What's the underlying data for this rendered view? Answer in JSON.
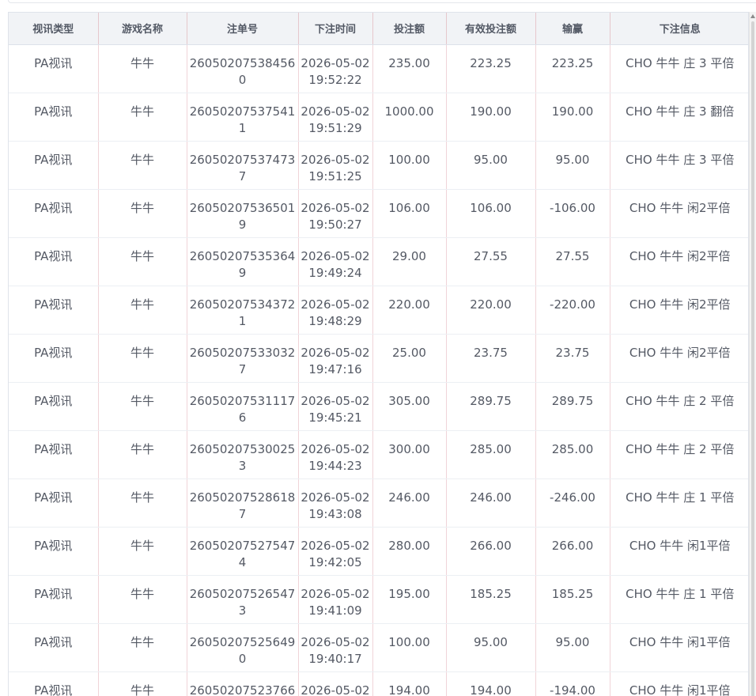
{
  "table": {
    "columns": [
      "视讯类型",
      "游戏名称",
      "注单号",
      "下注时间",
      "投注额",
      "有效投注额",
      "输赢",
      "下注信息"
    ],
    "rows": [
      [
        "PA视讯",
        "牛牛",
        "260502075384560",
        "2026-05-02 19:52:22",
        "235.00",
        "223.25",
        "223.25",
        "CHO 牛牛 庄 3 平倍"
      ],
      [
        "PA视讯",
        "牛牛",
        "260502075375411",
        "2026-05-02 19:51:29",
        "1000.00",
        "190.00",
        "190.00",
        "CHO 牛牛 庄 3 翻倍"
      ],
      [
        "PA视讯",
        "牛牛",
        "260502075374737",
        "2026-05-02 19:51:25",
        "100.00",
        "95.00",
        "95.00",
        "CHO 牛牛 庄 3 平倍"
      ],
      [
        "PA视讯",
        "牛牛",
        "260502075365019",
        "2026-05-02 19:50:27",
        "106.00",
        "106.00",
        "-106.00",
        "CHO 牛牛 闲2平倍"
      ],
      [
        "PA视讯",
        "牛牛",
        "260502075353649",
        "2026-05-02 19:49:24",
        "29.00",
        "27.55",
        "27.55",
        "CHO 牛牛 闲2平倍"
      ],
      [
        "PA视讯",
        "牛牛",
        "260502075343721",
        "2026-05-02 19:48:29",
        "220.00",
        "220.00",
        "-220.00",
        "CHO 牛牛 闲2平倍"
      ],
      [
        "PA视讯",
        "牛牛",
        "260502075330327",
        "2026-05-02 19:47:16",
        "25.00",
        "23.75",
        "23.75",
        "CHO 牛牛 闲2平倍"
      ],
      [
        "PA视讯",
        "牛牛",
        "260502075311176",
        "2026-05-02 19:45:21",
        "305.00",
        "289.75",
        "289.75",
        "CHO 牛牛 庄 2 平倍"
      ],
      [
        "PA视讯",
        "牛牛",
        "260502075300253",
        "2026-05-02 19:44:23",
        "300.00",
        "285.00",
        "285.00",
        "CHO 牛牛 庄 2 平倍"
      ],
      [
        "PA视讯",
        "牛牛",
        "260502075286187",
        "2026-05-02 19:43:08",
        "246.00",
        "246.00",
        "-246.00",
        "CHO 牛牛 庄 1 平倍"
      ],
      [
        "PA视讯",
        "牛牛",
        "260502075275474",
        "2026-05-02 19:42:05",
        "280.00",
        "266.00",
        "266.00",
        "CHO 牛牛 闲1平倍"
      ],
      [
        "PA视讯",
        "牛牛",
        "260502075265473",
        "2026-05-02 19:41:09",
        "195.00",
        "185.25",
        "185.25",
        "CHO 牛牛 庄 1 平倍"
      ],
      [
        "PA视讯",
        "牛牛",
        "260502075256490",
        "2026-05-02 19:40:17",
        "100.00",
        "95.00",
        "95.00",
        "CHO 牛牛 闲1平倍"
      ],
      [
        "PA视讯",
        "牛牛",
        "26050207523766",
        "2026-05-02",
        "194.00",
        "194.00",
        "-194.00",
        "CHO 牛牛 闲1平倍"
      ]
    ]
  }
}
